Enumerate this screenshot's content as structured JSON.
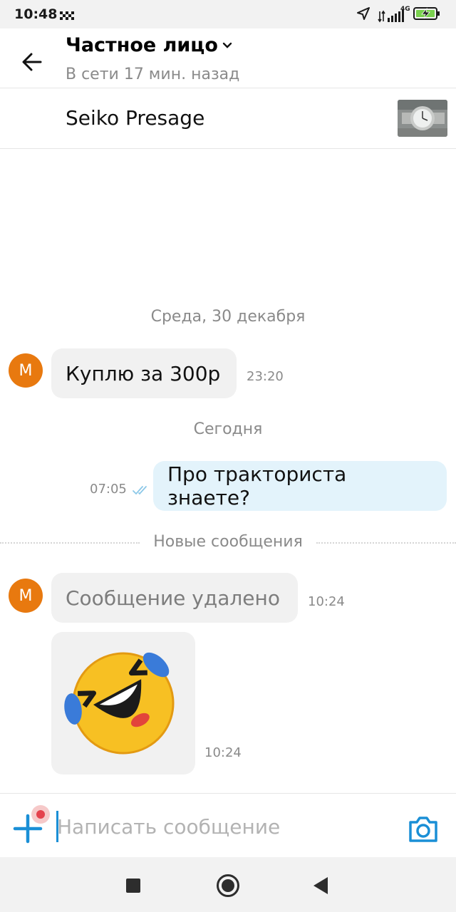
{
  "status_bar": {
    "time": "10:48",
    "network": "4G",
    "icons": [
      "taxi-icon",
      "location-arrow-icon",
      "signal-icon",
      "battery-charging-icon"
    ]
  },
  "header": {
    "title": "Частное лицо",
    "subtitle": "В сети 17 мин. назад",
    "icons": [
      "back-arrow-icon",
      "chevron-down-icon"
    ]
  },
  "listing": {
    "title": "Seiko Presage",
    "thumbnail": "watch-photo"
  },
  "chat": {
    "date_separators": [
      "Среда, 30 декабря",
      "Сегодня"
    ],
    "new_messages_label": "Новые сообщения",
    "messages": [
      {
        "from": "contact",
        "avatar": "M",
        "text": "Куплю за 300р",
        "time": "23:20"
      },
      {
        "from": "me",
        "text": "Про тракториста знаете?",
        "time": "07:05",
        "status": "read"
      },
      {
        "from": "contact",
        "avatar": "M",
        "text": "Сообщение удалено",
        "time": "10:24",
        "deleted": true
      },
      {
        "from": "contact",
        "sticker": "rolling-laughing-emoji",
        "time": "10:24"
      }
    ]
  },
  "input": {
    "placeholder": "Написать сообщение",
    "value": "",
    "icons": [
      "plus-icon",
      "camera-icon"
    ]
  },
  "colors": {
    "accent": "#1a8fd6",
    "avatar": "#e8790f",
    "outgoing_bubble": "#e3f3fb",
    "incoming_bubble": "#f1f1f1",
    "notification_dot": "#e4424d"
  },
  "nav_bar": {
    "buttons": [
      "recents-button",
      "home-button",
      "back-button"
    ]
  }
}
